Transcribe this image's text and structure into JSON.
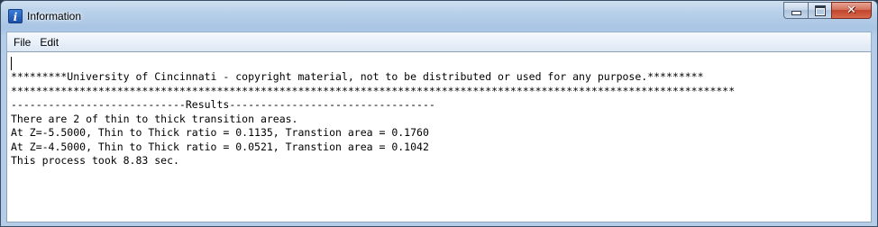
{
  "window": {
    "title": "Information",
    "icon": "info-icon",
    "caption_buttons": {
      "minimize_icon": "minimize-icon",
      "maximize_icon": "maximize-icon",
      "close_icon": "close-icon",
      "close_glyph": "✕"
    }
  },
  "menu": {
    "items": [
      {
        "label": "File"
      },
      {
        "label": "Edit"
      }
    ]
  },
  "output": {
    "lines": [
      "*********University of Cincinnati - copyright material, not to be distributed or used for any purpose.*********",
      "********************************************************************************************************************",
      "----------------------------Results---------------------------------",
      "There are 2 of thin to thick transition areas.",
      "At Z=-5.5000, Thin to Thick ratio = 0.1135, Transtion area = 0.1760",
      "At Z=-4.5000, Thin to Thick ratio = 0.0521, Transtion area = 0.1042",
      "This process took 8.83 sec."
    ]
  },
  "colors": {
    "titlebar": "#b9d1ea",
    "close_button": "#c2442a",
    "text_background": "#ffffff"
  }
}
